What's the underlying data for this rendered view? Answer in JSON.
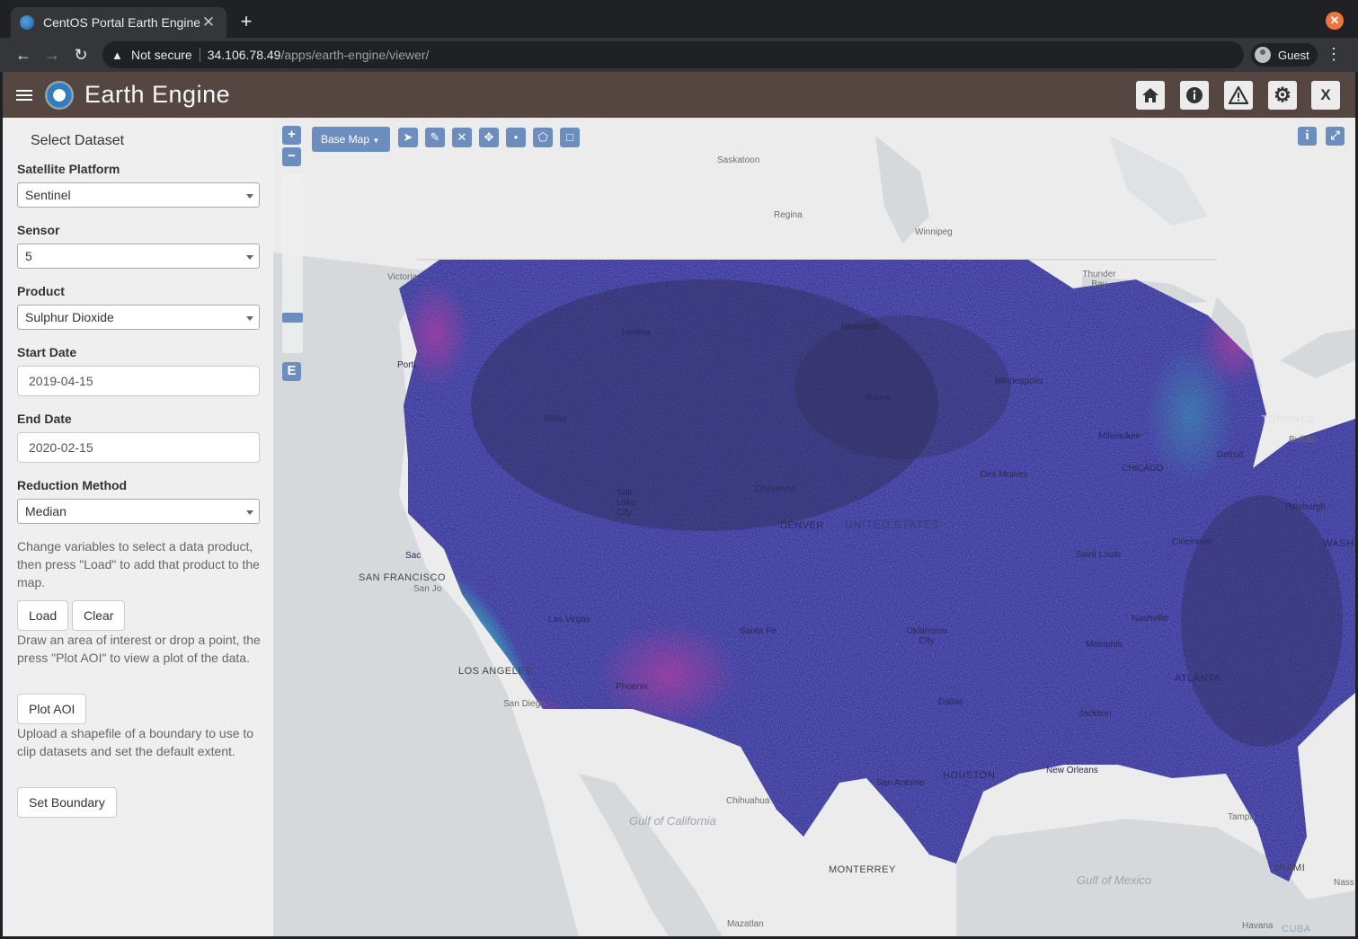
{
  "browser": {
    "tab_title": "CentOS Portal Earth Engine",
    "security_label": "Not secure",
    "url_host": "34.106.78.49",
    "url_path": "/apps/earth-engine/viewer/",
    "profile_label": "Guest"
  },
  "app": {
    "title": "Earth Engine",
    "header_buttons": [
      "home-icon",
      "info-icon",
      "warning-icon",
      "gear-icon",
      "close-icon"
    ],
    "close_label": "X"
  },
  "sidebar": {
    "title": "Select Dataset",
    "platform_label": "Satellite Platform",
    "platform_value": "Sentinel",
    "sensor_label": "Sensor",
    "sensor_value": "5",
    "product_label": "Product",
    "product_value": "Sulphur Dioxide",
    "start_label": "Start Date",
    "start_value": "2019-04-15",
    "end_label": "End Date",
    "end_value": "2020-02-15",
    "reduction_label": "Reduction Method",
    "reduction_value": "Median",
    "help_load": "Change variables to select a data product, then press \"Load\" to add that product to the map.",
    "load_label": "Load",
    "clear_label": "Clear",
    "help_plot": "Draw an area of interest or drop a point, the press \"Plot AOI\" to view a plot of the data.",
    "plot_label": "Plot AOI",
    "help_boundary": "Upload a shapefile of a boundary to use to clip datasets and set the default extent.",
    "boundary_label": "Set Boundary"
  },
  "map": {
    "zoom_in": "+",
    "zoom_out": "−",
    "edit_label": "E",
    "basemap_label": "Base Map",
    "info_label": "i",
    "places": {
      "saskatoon": "Saskatoon",
      "regina": "Regina",
      "winnipeg": "Winnipeg",
      "thunder_bay": "Thunder Bay",
      "victoria": "Victoria",
      "portland": "Portl",
      "helena": "Helena",
      "bismarck": "Bismarck",
      "pierre": "Pierre",
      "boise": "Boise",
      "minneapolis": "Minneapolis",
      "toronto": "TORONTO",
      "buffalo": "Buffalo",
      "milwaukee": "Milwaukee",
      "chicago": "CHICAGO",
      "detroit": "Detroit",
      "salt_lake": "Salt Lake City",
      "cheyenne": "Cheyenne",
      "des_moines": "Des Moines",
      "denver": "DENVER",
      "united_states": "UNITED STATES",
      "pittsburgh": "Pittsburgh",
      "sacramento": "Sac",
      "san_francisco": "SAN FRANCISCO",
      "san_jose": "San Jo",
      "cincinnati": "Cincinnati",
      "washington": "WASHING",
      "saint_louis": "Saint Louis",
      "las_vegas": "Las Vegas",
      "nashville": "Nashville",
      "santa_fe": "Santa Fe",
      "oklahoma": "Oklahoma City",
      "memphis": "Memphis",
      "los_angeles": "LOS ANGELES",
      "atlanta": "ATLANTA",
      "phoenix": "Phoenix",
      "san_diego": "San Diego",
      "dallas": "Dallas",
      "jackson": "Jackson",
      "houston": "HOUSTON",
      "new_orleans": "New Orleans",
      "san_antonio": "San Antonio",
      "chihuahua": "Chihuahua",
      "gulf_california": "Gulf of California",
      "tampa": "Tampa",
      "monterrey": "MONTERREY",
      "gulf_mexico": "Gulf of Mexico",
      "miami": "MIAMI",
      "nassau": "Nass",
      "mazatlan": "Mazatlan",
      "havana": "Havana",
      "cuba": "CUBA"
    }
  },
  "colors": {
    "header_bg": "#554642",
    "overlay_low": "#2f2f6b",
    "overlay_mid": "#4a4ae0",
    "overlay_high": "#2ee0c8",
    "overlay_pink": "#d23aa0"
  }
}
